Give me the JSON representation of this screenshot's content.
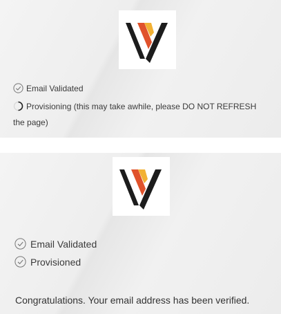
{
  "colors": {
    "logo_dark": "#1c1c1c",
    "logo_orange": "#e0522b",
    "logo_yellow": "#f2b134",
    "text": "#3a3a3a",
    "icon": "#777777"
  },
  "screens": {
    "in_progress": {
      "logo_icon": "brand-v-logo-icon",
      "steps": [
        {
          "label": "Email Validated",
          "state": "complete",
          "icon": "check-circle-icon"
        },
        {
          "label": "Provisioning (this may take awhile, please DO NOT REFRESH",
          "continuation": "the page)",
          "state": "in-progress",
          "icon": "spinner-icon"
        }
      ]
    },
    "complete": {
      "logo_icon": "brand-v-logo-icon",
      "steps": [
        {
          "label": "Email Validated",
          "state": "complete",
          "icon": "check-circle-icon"
        },
        {
          "label": "Provisioned",
          "state": "complete",
          "icon": "check-circle-icon"
        }
      ],
      "message": "Congratulations. Your email address has been verified."
    }
  }
}
